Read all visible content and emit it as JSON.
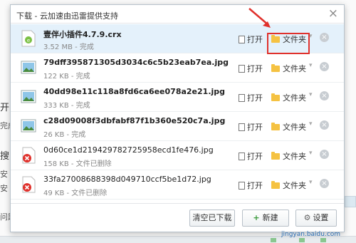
{
  "dialog": {
    "title": "下载 - 云加速由迅雷提供支持",
    "close_glyph": "×"
  },
  "items": [
    {
      "name": "壹伴小插件4.7.9.crx",
      "size": "3.52 MB",
      "status": "完成",
      "open_label": "打开",
      "folder_label": "文件夹",
      "type": "crx",
      "deleted": false
    },
    {
      "name": "79dff395871305d3034c6c5b23eab7ea.jpg",
      "size": "122 KB",
      "status": "完成",
      "open_label": "打开",
      "folder_label": "文件夹",
      "type": "jpg",
      "deleted": false
    },
    {
      "name": "40dd98e11c118a8fd6ca6ee078a2e21.jpg",
      "size": "333 KB",
      "status": "完成",
      "open_label": "打开",
      "folder_label": "文件夹",
      "type": "jpg",
      "deleted": false
    },
    {
      "name": "c28d09008f3dbfabf87f1b360e520c7a.jpg",
      "size": "26 KB",
      "status": "完成",
      "open_label": "打开",
      "folder_label": "文件夹",
      "type": "jpg",
      "deleted": false
    },
    {
      "name": "0d60ce1d219429782725958ecd1fe476.jpg",
      "size": "158 KB",
      "status": "文件已删除",
      "open_label": "打开",
      "folder_label": "文件夹",
      "type": "deleted",
      "deleted": true
    },
    {
      "name": "33fa27008688398d049710ccf5be1d72.jpg",
      "size": "49 KB",
      "status": "文件已删除",
      "open_label": "打开",
      "folder_label": "文件夹",
      "type": "deleted",
      "deleted": true
    }
  ],
  "meta_separator": " - ",
  "footer": {
    "clear_label": "清空已下载",
    "new_label": "新建",
    "settings_label": "设置"
  },
  "background": {
    "frag1": "开",
    "frag2": "完成",
    "frag3": "搜",
    "frag4": "安",
    "frag5": "安",
    "frag6": "问题"
  },
  "watermark": "jingyan.baidu.com",
  "colors": {
    "accent_red": "#e0312c",
    "selected_row": "#e4f1fb",
    "folder_yellow": "#f5c242"
  }
}
